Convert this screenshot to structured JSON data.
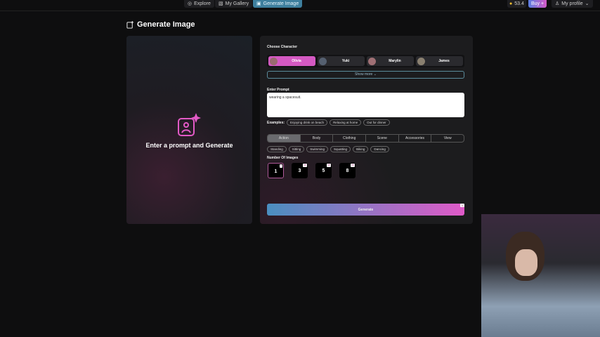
{
  "topbar": {
    "nav": [
      "Explore",
      "My Gallery",
      "Generate Image"
    ],
    "coins": "53.4",
    "buy": "Buy +",
    "profile": "My profile"
  },
  "page_title": "Generate Image",
  "preview": {
    "message": "Enter a prompt and Generate"
  },
  "character": {
    "label": "Choose Character",
    "items": [
      "Olivia",
      "Yuki",
      "Marylin",
      "James"
    ],
    "selected": "Olivia",
    "show_more": "Show more"
  },
  "prompt": {
    "label": "Enter Prompt",
    "value": "wearing a spacesuit."
  },
  "examples": {
    "label": "Examples:",
    "items": [
      "Enjoying drink on beach",
      "Relaxing at home",
      "Out for dinner"
    ]
  },
  "tabs": {
    "items": [
      "Action",
      "Body",
      "Clothing",
      "Scene",
      "Accessories",
      "View"
    ],
    "selected": "Action"
  },
  "actions": [
    "Standing",
    "Sitting",
    "Swimming",
    "Squatting",
    "Biking",
    "Dancing"
  ],
  "num_images": {
    "label": "Number Of Images",
    "options": [
      {
        "n": "1",
        "cost": "4"
      },
      {
        "n": "3",
        "cost": "10"
      },
      {
        "n": "5",
        "cost": "15"
      },
      {
        "n": "8",
        "cost": "20"
      }
    ],
    "selected": "1"
  },
  "generate": {
    "label": "Generate",
    "cost": "4"
  },
  "colors": {
    "accent": "#d459c2",
    "gradient_start": "#4a8ec0",
    "gradient_end": "#e05ac8"
  }
}
